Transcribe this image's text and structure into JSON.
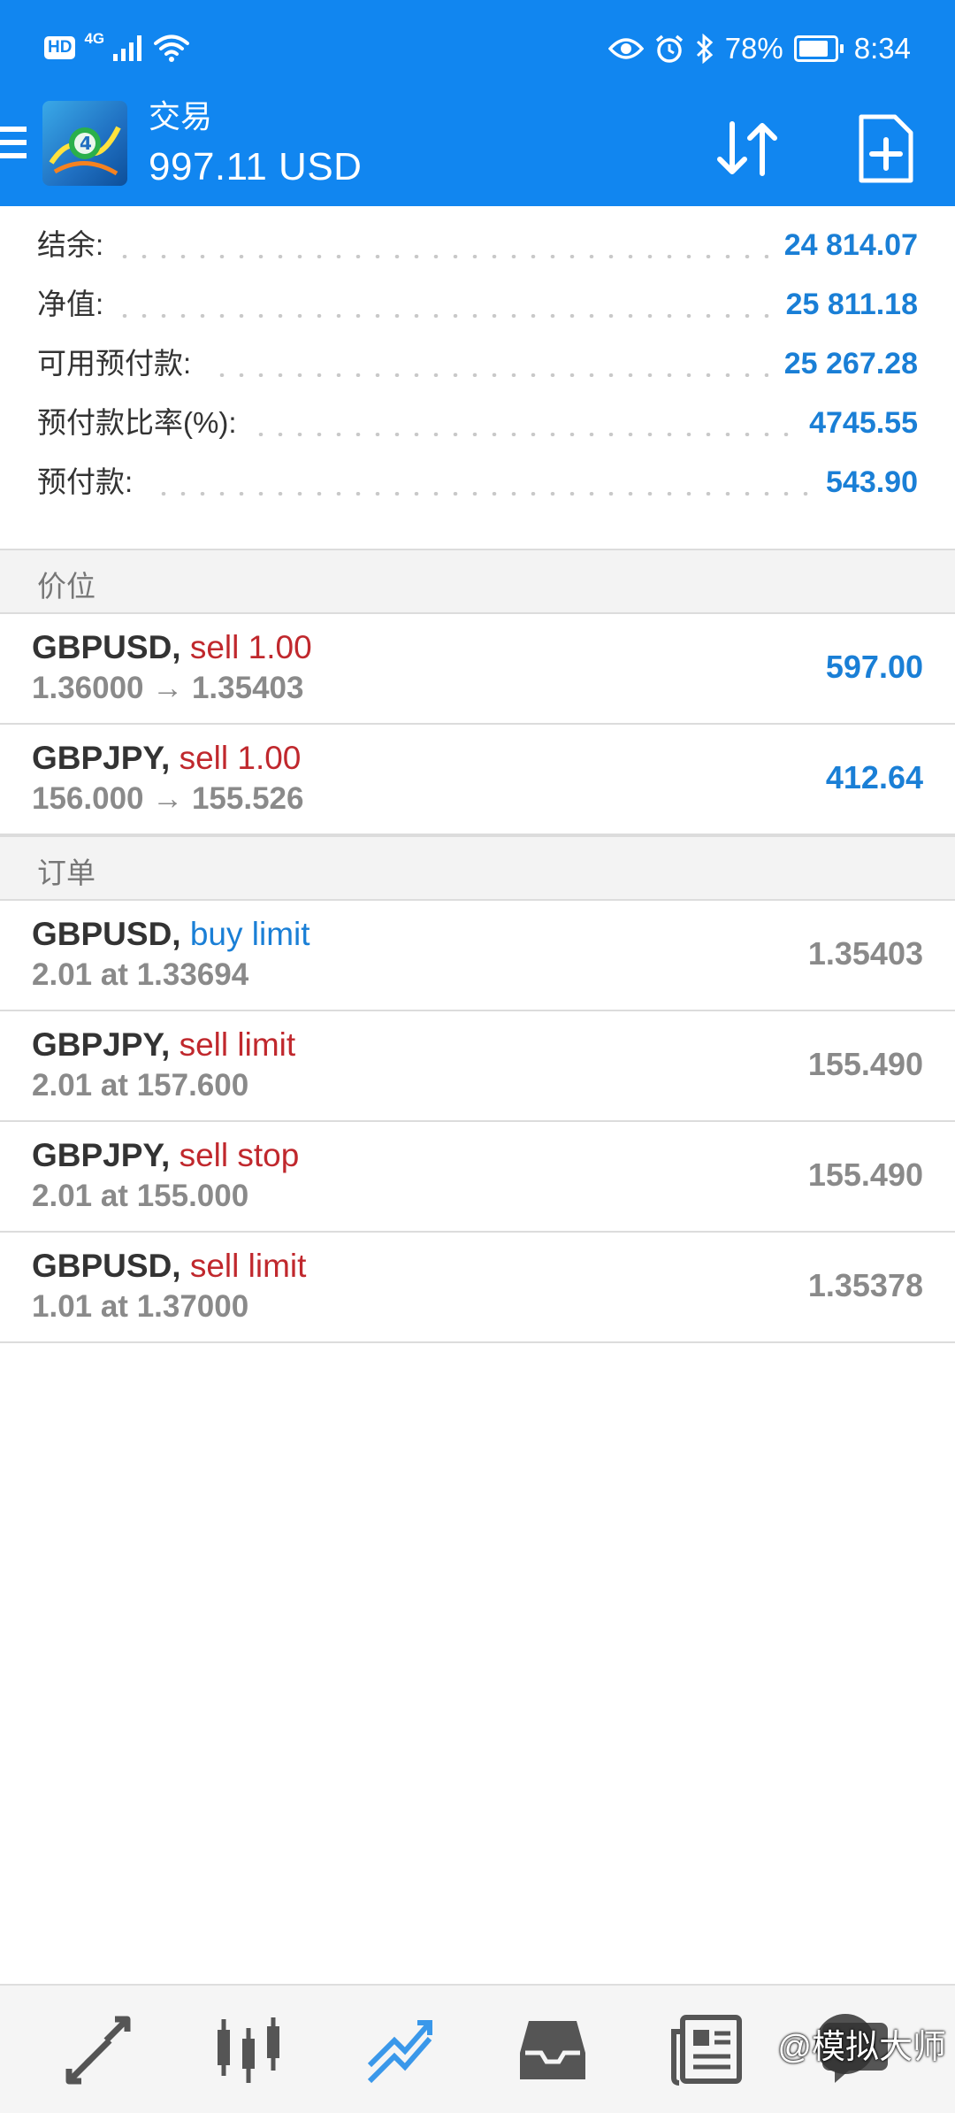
{
  "status_bar": {
    "hd": "HD",
    "network": "4G",
    "battery": "78%",
    "time": "8:34",
    "battery_level": 0.78
  },
  "header": {
    "title": "交易",
    "balance": "997.11 USD",
    "background": "#1186f0"
  },
  "summary": [
    {
      "label": "结余:",
      "value": "24 814.07"
    },
    {
      "label": "净值:",
      "value": "25 811.18"
    },
    {
      "label": "可用预付款:",
      "value": "25 267.28"
    },
    {
      "label": "预付款比率(%):",
      "value": "4745.55"
    },
    {
      "label": "预付款:",
      "value": "543.90"
    }
  ],
  "positions": {
    "section_label": "价位",
    "items": [
      {
        "symbol": "GBPUSD,",
        "type": "sell 1.00",
        "prices": "1.36000 → 1.35403",
        "profit": "597.00"
      },
      {
        "symbol": "GBPJPY,",
        "type": "sell 1.00",
        "prices": "156.000 → 155.526",
        "profit": "412.64"
      }
    ]
  },
  "orders": {
    "section_label": "订单",
    "items": [
      {
        "symbol": "GBPUSD,",
        "type": "buy limit",
        "detail": "2.01 at 1.33694",
        "price": "1.35403"
      },
      {
        "symbol": "GBPJPY,",
        "type": "sell limit",
        "detail": "2.01 at 157.600",
        "price": "155.490"
      },
      {
        "symbol": "GBPJPY,",
        "type": "sell stop",
        "detail": "2.01 at 155.000",
        "price": "155.490"
      },
      {
        "symbol": "GBPUSD,",
        "type": "sell limit",
        "detail": "1.01 at 1.37000",
        "price": "1.35378"
      }
    ]
  },
  "bottom_nav": [
    {
      "icon": "quotes-icon"
    },
    {
      "icon": "chart-icon"
    },
    {
      "icon": "trade-icon",
      "active": true
    },
    {
      "icon": "history-icon"
    },
    {
      "icon": "news-icon"
    },
    {
      "icon": "messages-icon"
    }
  ],
  "watermark": "@模拟大师",
  "colors": {
    "accent": "#1186f0",
    "value_blue": "#1a7fd6",
    "sell_red": "#c0282d",
    "nav_active": "#3a98ea"
  }
}
